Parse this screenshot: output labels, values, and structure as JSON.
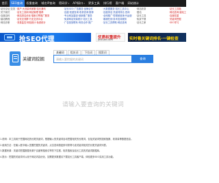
{
  "nav": {
    "items": [
      {
        "label": "首页",
        "active": false,
        "dropdown": false
      },
      {
        "label": "SEO查询",
        "active": true,
        "dropdown": false
      },
      {
        "label": "权重查询",
        "active": false,
        "dropdown": false
      },
      {
        "label": "域名IP查询",
        "active": false,
        "dropdown": false
      },
      {
        "label": "密码学",
        "active": false,
        "dropdown": true
      },
      {
        "label": "API接口",
        "active": false,
        "dropdown": true
      },
      {
        "label": "更多工具",
        "active": false,
        "dropdown": false
      },
      {
        "label": "排行榜",
        "active": false,
        "dropdown": false
      },
      {
        "label": "客户端",
        "active": false,
        "dropdown": false
      },
      {
        "label": "网站统计",
        "active": false,
        "dropdown": false
      }
    ]
  },
  "links": {
    "col1": [
      "·站长论坛·交流",
      "·关于我们",
      "·百度百科",
      "·建站教程",
      "·网站诊断"
    ],
    "col2": [
      "·用户·大流量商家服·站长通讯",
      "·站长工具网·网站管理·推荐",
      "·网站排名优化·搜索引擎推广服务",
      "·站长交流群·行业交流平台",
      "·流量监控·网站统计·免费统计"
    ],
    "col3": [
      "·站长SEO·广告服务·品牌合作",
      "·百度·权重查询·收录查询·推荐",
      "·专业网站建设·营销推广服务",
      "·免费网站流量统计·站长工具",
      "·广告投放联系·商务合作·推广"
    ],
    "col4": [
      "·大数据服务·站长工具中心",
      "·百度排名·关键词排名·查询",
      "·全网推广·短视频营销·代运营",
      "·客服在线·技术支持服务",
      "·站长工具帮助·网站查询"
    ],
    "col5": [
      "·网站收录",
      "·爱站",
      "·站长工具",
      "·免费下载",
      "·站长之家"
    ],
    "col6": [
      "·站长工具箱",
      "·网站查询·建站工具",
      "·百度权重",
      "·关键词挖掘",
      "·SEO学习"
    ]
  },
  "ads": {
    "left": "抢SEO代理",
    "mid_top": "优质权重提升",
    "mid_bottom": "jinxuan.com",
    "right": "实时看关键词排名·一键检查"
  },
  "tool": {
    "title": "关键词挖掘",
    "tabs": [
      "关键词",
      "相关词",
      "下拉词",
      "搜索词"
    ],
    "placeholder": "请输入要挖掘的关键词",
    "button": "查询"
  },
  "hint": "请输入要查询的关键词",
  "notes": [
    "1.说明：本工具用于挖掘网站的长尾关键词，根据输入的关键词自动挖掘相关的长尾词，包括关键词的搜索指数、收录量等数据信息。",
    "2.使用方法：在输入框中输入您要挖掘的关键词，点击查询按钮即可获得与该关键词相关的长尾关键词列表。",
    "3.数据来源：关键词挖掘数据来源于百度等搜索引擎的下拉框、相关搜索及站长工具的关键词数据库。",
    "4.提示：挖掘的关键词可以用于网站内容优化，如需更多数据请下载站长工具客户端，体验更多SEO实用工具功能。"
  ]
}
